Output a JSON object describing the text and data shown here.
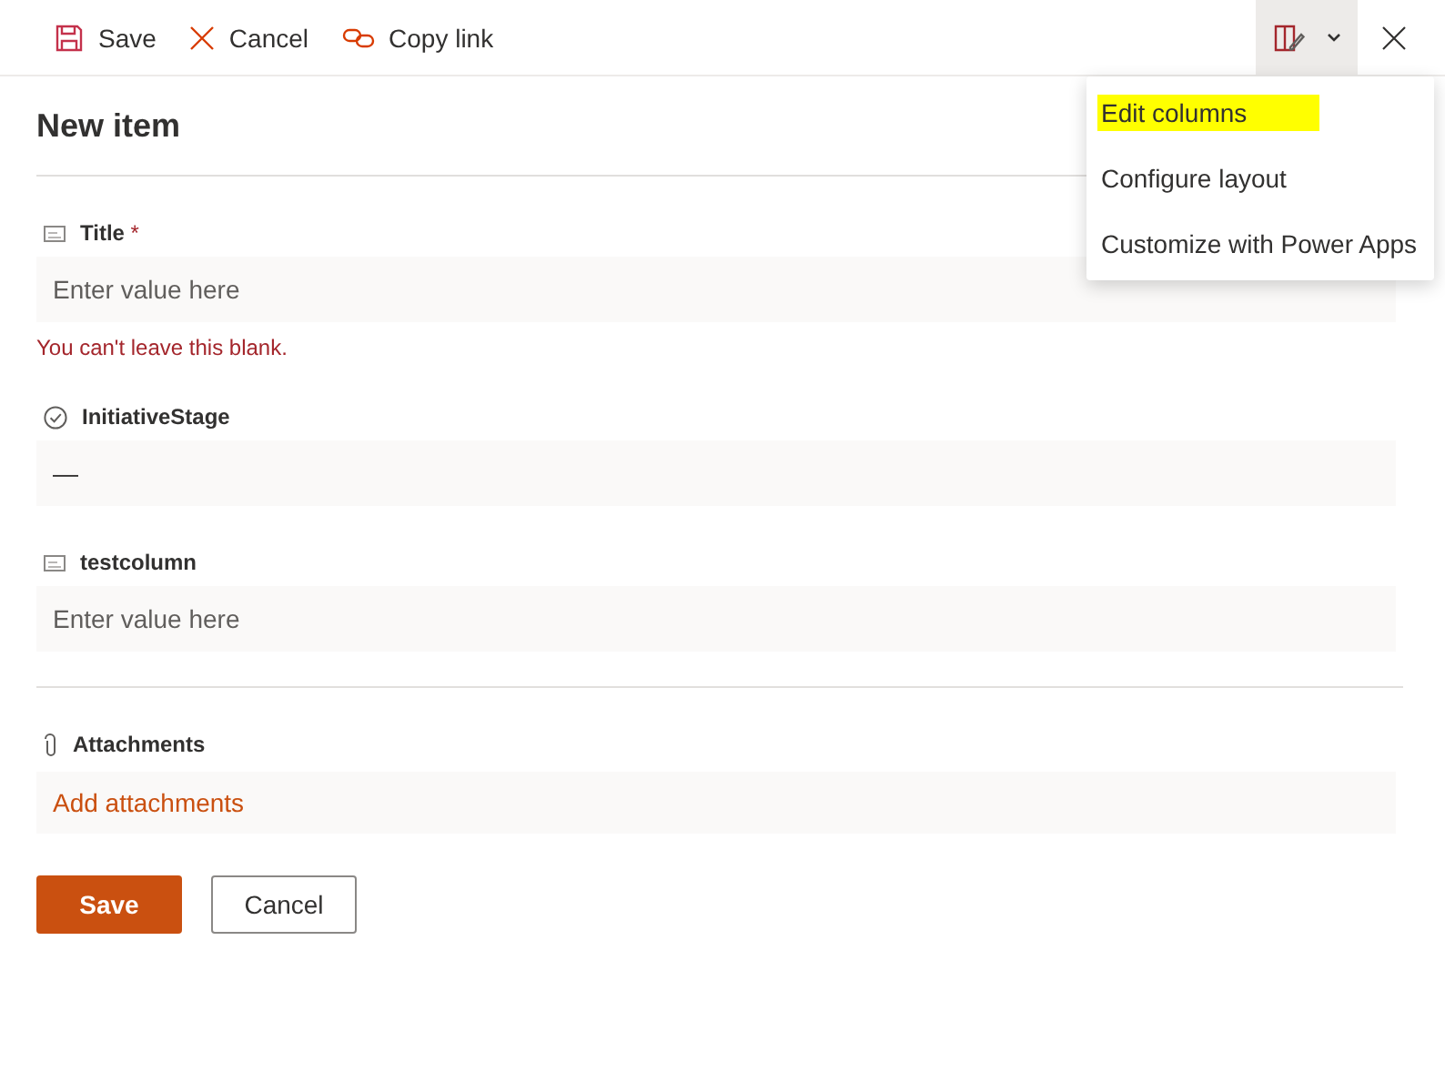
{
  "toolbar": {
    "actions": [
      {
        "kind": "save",
        "label": "Save"
      },
      {
        "kind": "cancel",
        "label": "Cancel"
      },
      {
        "kind": "link",
        "label": "Copy link"
      }
    ],
    "menu_expanded": true
  },
  "menu": {
    "items": [
      {
        "label": "Edit columns",
        "highlighted": true
      },
      {
        "label": "Configure layout",
        "highlighted": false
      },
      {
        "label": "Customize with Power Apps",
        "highlighted": false
      }
    ]
  },
  "panel": {
    "title": "New item"
  },
  "fields": [
    {
      "kind": "text",
      "label": "Title",
      "required_mark": "*",
      "placeholder": "Enter value here",
      "error": "You can't leave this blank."
    },
    {
      "kind": "choice",
      "label": "InitiativeStage",
      "value": "—"
    },
    {
      "kind": "text",
      "label": "testcolumn",
      "placeholder": "Enter value here"
    }
  ],
  "attachments": {
    "label": "Attachments",
    "link": "Add attachments"
  },
  "buttons": [
    {
      "kind": "primary",
      "label": "Save"
    },
    {
      "kind": "default",
      "label": "Cancel"
    }
  ]
}
